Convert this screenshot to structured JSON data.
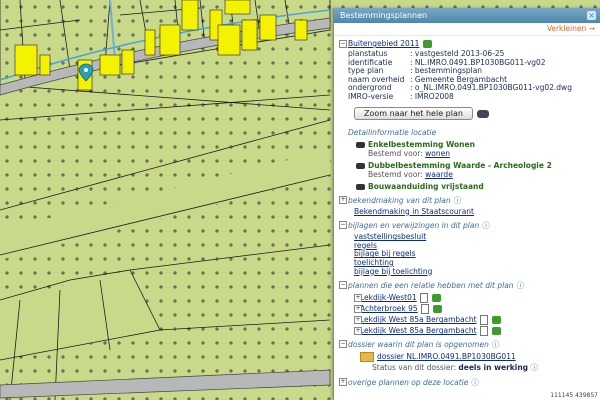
{
  "panel": {
    "title": "Bestemmingsplannen",
    "smaller_label": "Verkleinen",
    "plan": {
      "name": "Buitengebied 2011",
      "rows": [
        {
          "k": "planstatus",
          "v": ": vastgesteld 2013-06-25"
        },
        {
          "k": "identificatie",
          "v": ": NL.IMRO.0491.BP1030BG011-vg02"
        },
        {
          "k": "type plan",
          "v": ": bestemmingsplan"
        },
        {
          "k": "naam overheid",
          "v": ": Gemeente Bergambacht"
        },
        {
          "k": "ondergrond",
          "v": ": o_NL.IMRO.0491.BP1030BG011-vg02.dwg"
        },
        {
          "k": "IMRO-versie",
          "v": ": IMRO2008"
        }
      ],
      "zoom_button": "Zoom naar het hele plan"
    },
    "detail_title": "Detailinformatie locatie",
    "details": [
      {
        "name": "Enkelbestemming Wonen",
        "bestemd": "Bestemd voor:",
        "value": "wonen"
      },
      {
        "name": "Dubbelbestemming Waarde - Archeologie 2",
        "bestemd": "Bestemd voor:",
        "value": "waarde"
      },
      {
        "name": "Bouwaanduiding vrijstaand",
        "bestemd": "",
        "value": ""
      }
    ],
    "bekend_title": "bekendmaking van dit plan",
    "bekend_link": "Bekendmaking in Staatscourant",
    "bijlagen_title": "bijlagen en verwijzingen in dit plan",
    "bijlagen": [
      "vaststellingsbesluit",
      "regels",
      "bijlage bij regels",
      "toelichting",
      "bijlage bij toelichting"
    ],
    "relatie_title": "plannen die een relatie hebben met dit plan",
    "relaties": [
      "Lekdijk-West01",
      "Achterbroek 95",
      "Lekdijk West 85a Bergambacht",
      "Lekdijk West 85a Bergambacht"
    ],
    "dossier_title": "dossier waarin dit plan is opgenomen",
    "dossier_link": "dossier NL.IMRO.0491.BP1030BG011",
    "dossier_status_label": "Status van dit dossier:",
    "dossier_status": "deels in werking",
    "overige_title": "overige plannen op deze locatie"
  },
  "map": {
    "marker_icon": "location-pin-icon",
    "scale_text": "111145 439857"
  },
  "colors": {
    "accent": "#4f86ab",
    "map_bg": "#c9d98a",
    "plot_yellow": "#f5f200",
    "road": "#b8b8b8"
  }
}
